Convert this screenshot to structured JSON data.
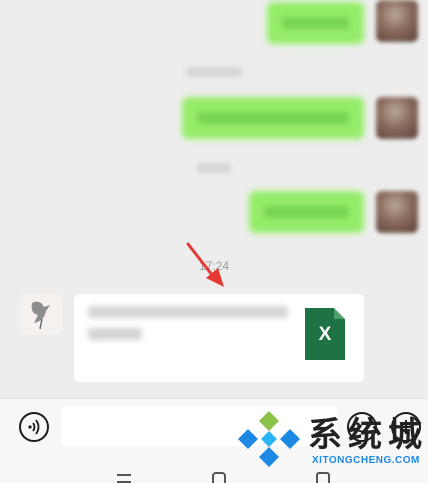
{
  "chat": {
    "timestamp_visible": "17:24",
    "file_message": {
      "file_type_icon": "excel-icon",
      "icon_letter": "X",
      "icon_color": "#1f7244"
    }
  },
  "input_bar": {
    "text_value": "",
    "voice_icon": "voice-icon",
    "emoji_icon": "emoji-icon",
    "plus_icon": "plus-icon"
  },
  "watermark": {
    "title": "系统城",
    "url": "XITONGCHENG.COM"
  },
  "colors": {
    "sent_bubble": "#95ec69",
    "chat_bg": "#ededed",
    "arrow": "#e53935"
  }
}
